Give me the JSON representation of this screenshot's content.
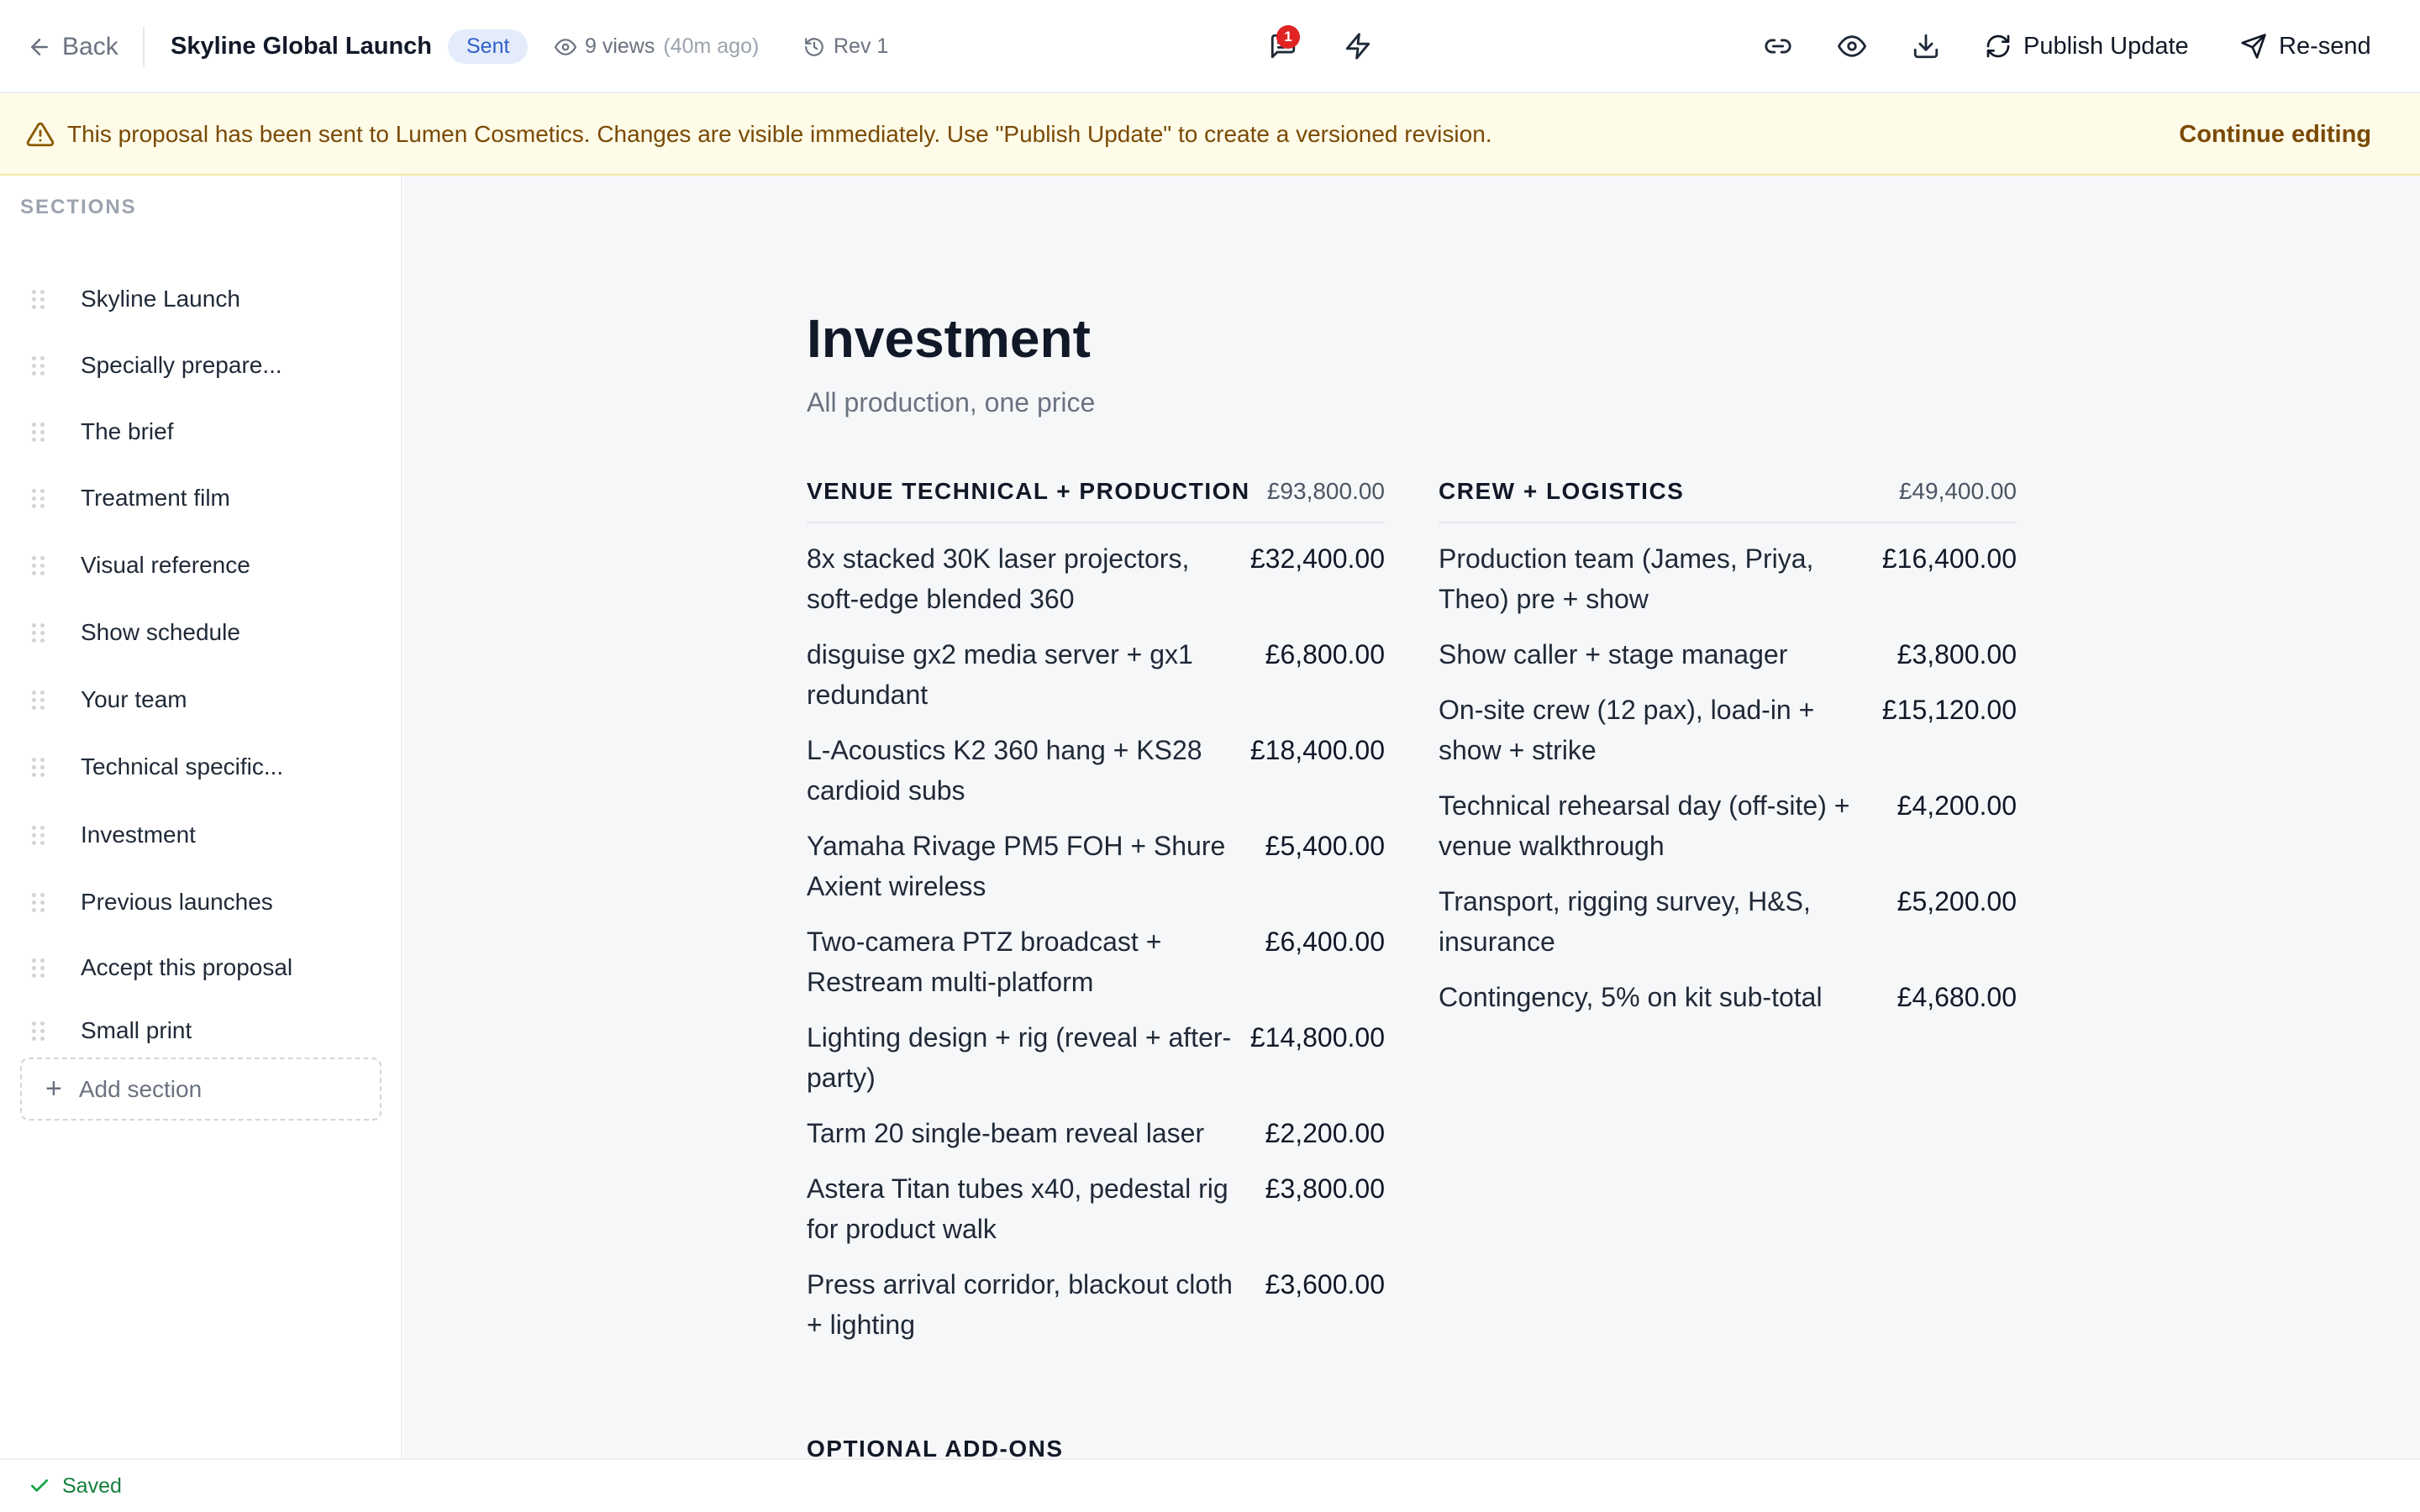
{
  "header": {
    "back_label": "Back",
    "doc_title": "Skyline Global Launch",
    "status": "Sent",
    "views": "9 views",
    "views_ago": "(40m ago)",
    "revision": "Rev 1",
    "notification_count": "1",
    "publish_label": "Publish Update",
    "resend_label": "Re-send"
  },
  "banner": {
    "message": "This proposal has been sent to Lumen Cosmetics. Changes are visible immediately. Use \"Publish Update\" to create a versioned revision.",
    "action": "Continue editing"
  },
  "sidebar": {
    "heading": "SECTIONS",
    "items": [
      {
        "label": "Skyline Launch"
      },
      {
        "label": "Specially prepare..."
      },
      {
        "label": "The brief"
      },
      {
        "label": "Treatment film"
      },
      {
        "label": "Visual reference"
      },
      {
        "label": "Show schedule"
      },
      {
        "label": "Your team"
      },
      {
        "label": "Technical specific..."
      },
      {
        "label": "Investment"
      },
      {
        "label": "Previous launches"
      },
      {
        "label": "Accept this proposal"
      },
      {
        "label": "Small print"
      }
    ],
    "add_label": "Add section"
  },
  "main": {
    "title": "Investment",
    "subtitle": "All production, one price",
    "groups": [
      {
        "name": "VENUE TECHNICAL + PRODUCTION",
        "total": "£93,800.00",
        "lines": [
          {
            "desc": "8x stacked 30K laser projectors, soft-edge blended 360",
            "amount": "£32,400.00"
          },
          {
            "desc": "disguise gx2 media server + gx1 redundant",
            "amount": "£6,800.00"
          },
          {
            "desc": "L-Acoustics K2 360 hang + KS28 cardioid subs",
            "amount": "£18,400.00"
          },
          {
            "desc": "Yamaha Rivage PM5 FOH + Shure Axient wireless",
            "amount": "£5,400.00"
          },
          {
            "desc": "Two-camera PTZ broadcast + Restream multi-platform",
            "amount": "£6,400.00"
          },
          {
            "desc": "Lighting design + rig (reveal + after-party)",
            "amount": "£14,800.00"
          },
          {
            "desc": "Tarm 20 single-beam reveal laser",
            "amount": "£2,200.00"
          },
          {
            "desc": "Astera Titan tubes x40, pedestal rig for product walk",
            "amount": "£3,800.00"
          },
          {
            "desc": "Press arrival corridor, blackout cloth + lighting",
            "amount": "£3,600.00"
          }
        ]
      },
      {
        "name": "CREW + LOGISTICS",
        "total": "£49,400.00",
        "lines": [
          {
            "desc": "Production team (James, Priya, Theo) pre + show",
            "amount": "£16,400.00"
          },
          {
            "desc": "Show caller + stage manager",
            "amount": "£3,800.00"
          },
          {
            "desc": "On-site crew (12 pax), load-in + show + strike",
            "amount": "£15,120.00"
          },
          {
            "desc": "Technical rehearsal day (off-site) + venue walkthrough",
            "amount": "£4,200.00"
          },
          {
            "desc": "Transport, rigging survey, H&S, insurance",
            "amount": "£5,200.00"
          },
          {
            "desc": "Contingency, 5% on kit sub-total",
            "amount": "£4,680.00"
          }
        ]
      }
    ],
    "addons_heading": "OPTIONAL ADD-ONS"
  },
  "footer": {
    "status": "Saved"
  }
}
